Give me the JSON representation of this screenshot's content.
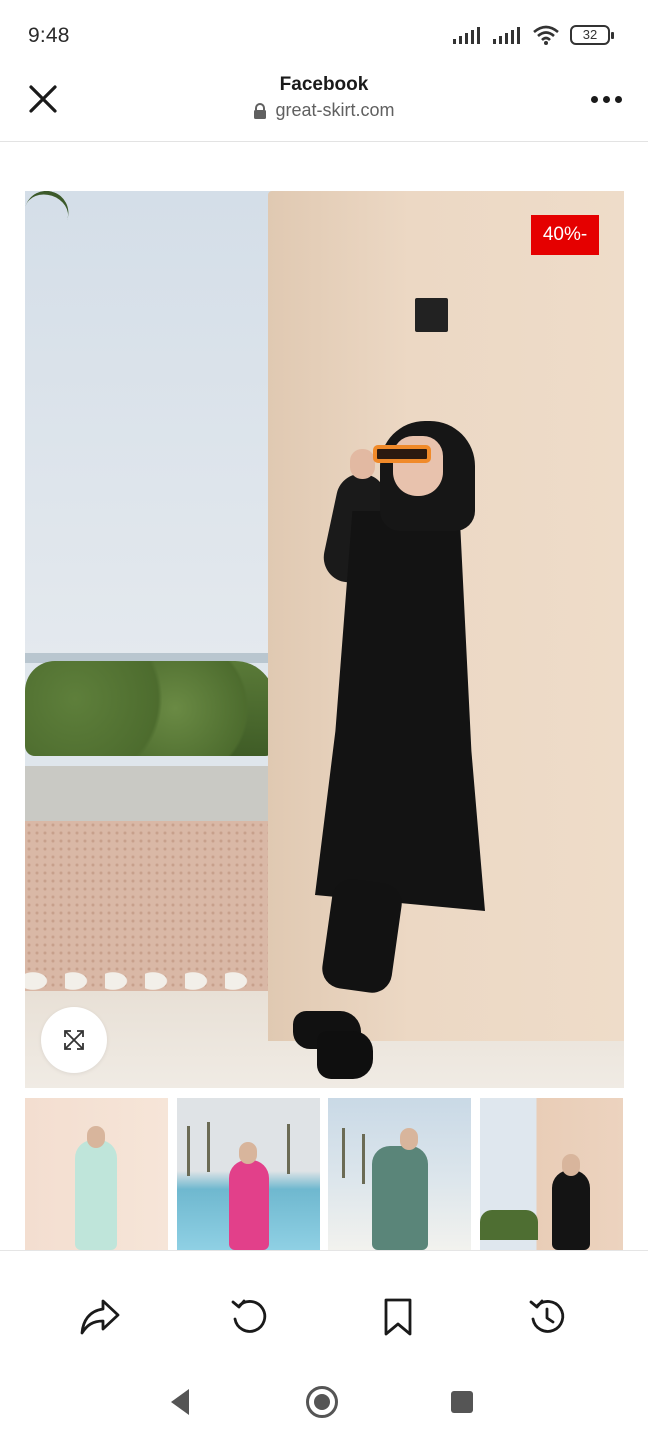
{
  "status_bar": {
    "time": "9:48",
    "battery": "32",
    "icons": [
      "signal-icon",
      "signal-icon",
      "wifi-icon",
      "battery-icon"
    ]
  },
  "header": {
    "title": "Facebook",
    "url": "great-skirt.com",
    "close_icon": "close-icon",
    "lock_icon": "lock-icon",
    "more_icon": "more-options-icon"
  },
  "product": {
    "discount_badge": "40%-",
    "expand_icon": "expand-icon",
    "thumbnails": [
      {
        "name": "thumbnail-mint-outfit",
        "accent": "#bfe5da"
      },
      {
        "name": "thumbnail-pink-outfit",
        "accent": "#e2408a"
      },
      {
        "name": "thumbnail-green-outfit",
        "accent": "#5a8579"
      },
      {
        "name": "thumbnail-black-outfit",
        "accent": "#141414"
      }
    ]
  },
  "toolbar": {
    "buttons": [
      "share-icon",
      "refresh-icon",
      "bookmark-icon",
      "history-icon"
    ]
  },
  "nav": {
    "buttons": [
      "back-icon",
      "home-icon",
      "recents-icon"
    ]
  },
  "colors": {
    "badge": "#e50000",
    "text": "#1a1a1a",
    "url": "#606060"
  }
}
